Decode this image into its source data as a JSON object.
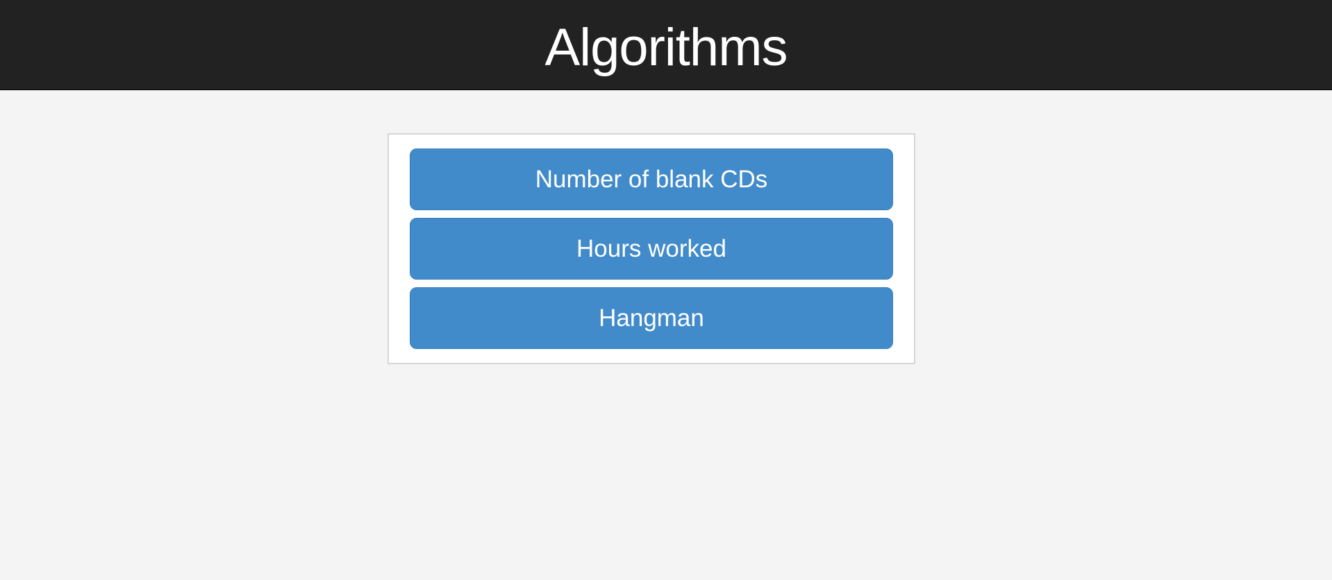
{
  "header": {
    "title": "Algorithms"
  },
  "menu": {
    "items": [
      {
        "label": "Number of blank CDs"
      },
      {
        "label": "Hours worked"
      },
      {
        "label": "Hangman"
      }
    ]
  },
  "colors": {
    "header_bg": "#222222",
    "page_bg": "#f4f4f4",
    "button_bg": "#428bca",
    "button_text": "#ffffff"
  }
}
